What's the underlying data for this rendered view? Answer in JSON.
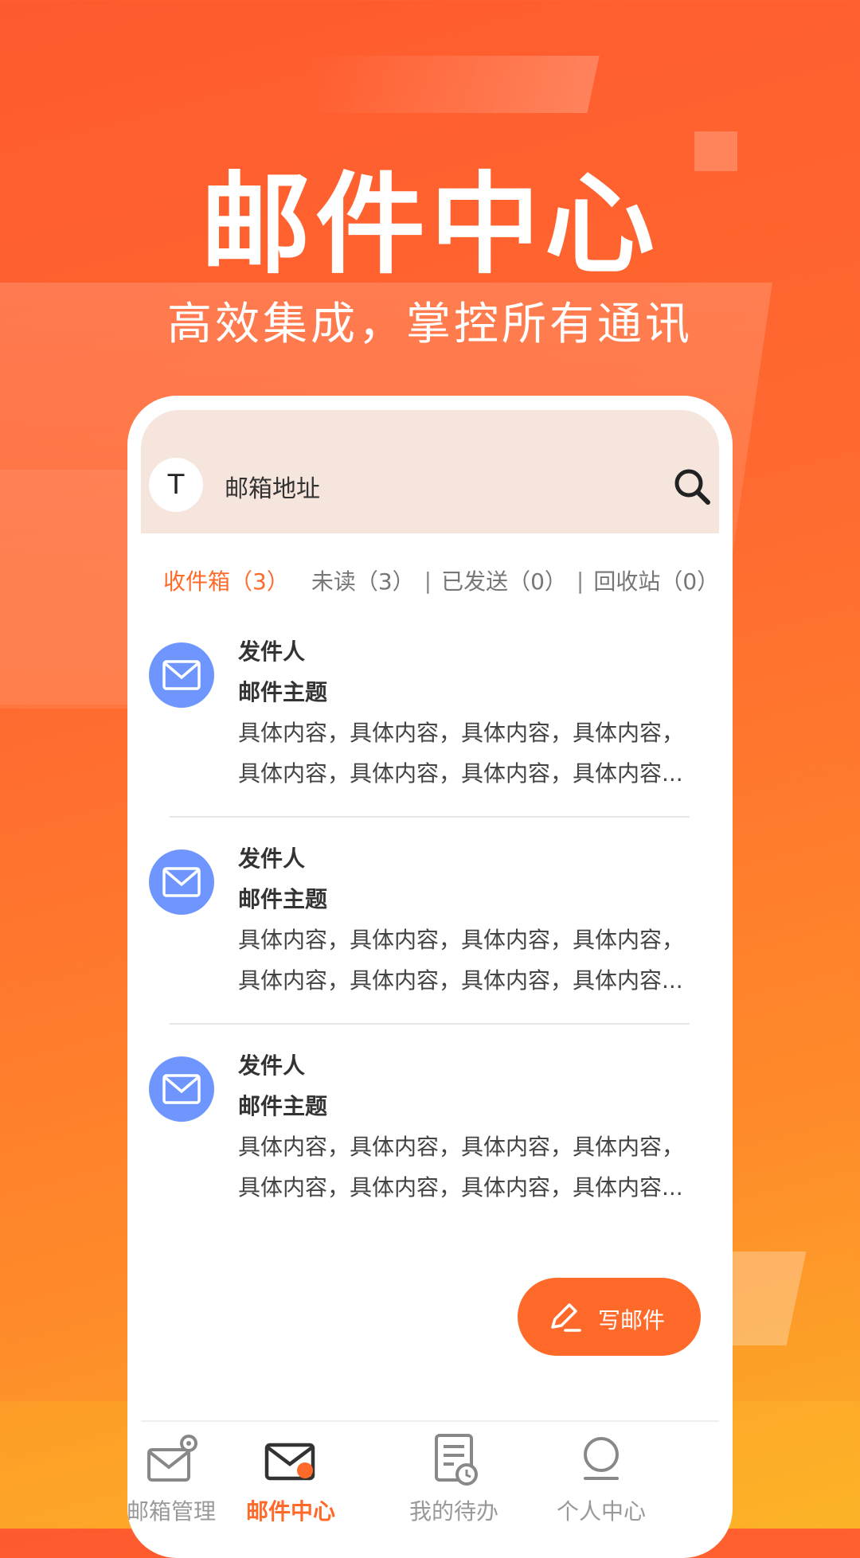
{
  "hero": {
    "title": "邮件中心",
    "subtitle": "高效集成，掌控所有通讯"
  },
  "header": {
    "avatar_letter": "T",
    "address_label": "邮箱地址",
    "search_icon": "search-icon"
  },
  "tabs": [
    {
      "label": "收件箱（3）",
      "active": true
    },
    {
      "label": "未读（3）",
      "active": false
    },
    {
      "label": "已发送（0）",
      "active": false
    },
    {
      "label": "回收站（0）",
      "active": false
    }
  ],
  "separator": "|",
  "mails": [
    {
      "sender": "发件人",
      "subject": "邮件主题",
      "line1": "具体内容，具体内容，具体内容，具体内容，",
      "line2": "具体内容，具体内容，具体内容，具体内容..."
    },
    {
      "sender": "发件人",
      "subject": "邮件主题",
      "line1": "具体内容，具体内容，具体内容，具体内容，",
      "line2": "具体内容，具体内容，具体内容，具体内容..."
    },
    {
      "sender": "发件人",
      "subject": "邮件主题",
      "line1": "具体内容，具体内容，具体内容，具体内容，",
      "line2": "具体内容，具体内容，具体内容，具体内容..."
    }
  ],
  "compose": {
    "label": "写邮件",
    "icon": "pen-icon"
  },
  "tabbar": [
    {
      "label": "邮箱管理",
      "icon": "mailbox-settings-icon",
      "active": false
    },
    {
      "label": "邮件中心",
      "icon": "mail-center-icon",
      "active": true
    },
    {
      "label": "我的待办",
      "icon": "todo-clock-icon",
      "active": false
    },
    {
      "label": "个人中心",
      "icon": "user-icon",
      "active": false
    }
  ],
  "colors": {
    "accent": "#ff6a2b",
    "mail_icon_bg": "#6f96ff",
    "header_bg": "#f6e5dd"
  }
}
